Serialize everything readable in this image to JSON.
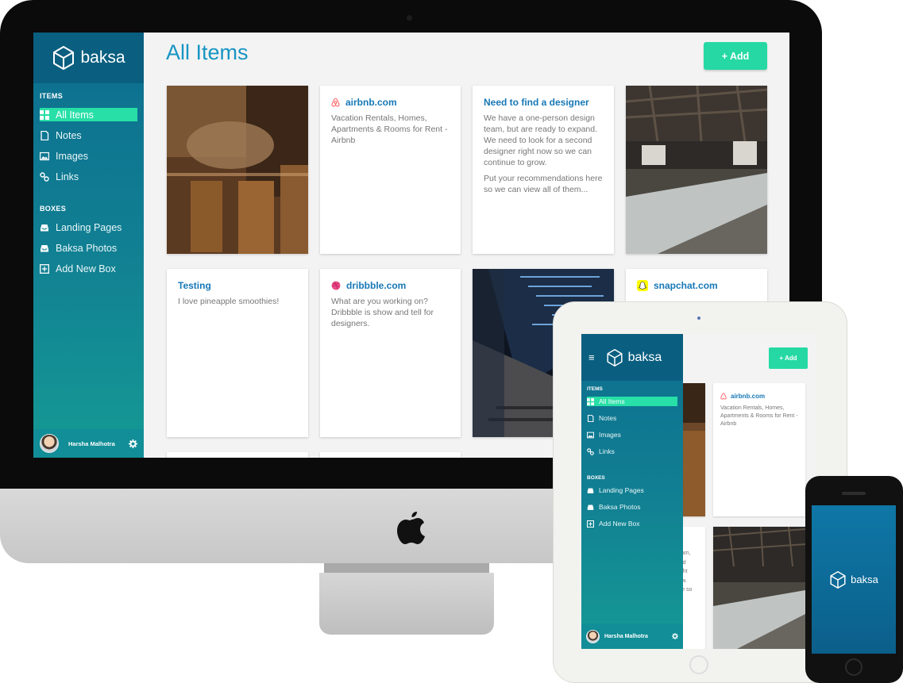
{
  "desktop": {
    "brand": "baksa",
    "page_title": "All Items",
    "add_button": "+ Add",
    "sidebar": {
      "items_heading": "ITEMS",
      "items": [
        {
          "label": "All Items",
          "icon": "grid-icon",
          "active": true
        },
        {
          "label": "Notes",
          "icon": "note-icon"
        },
        {
          "label": "Images",
          "icon": "image-icon"
        },
        {
          "label": "Links",
          "icon": "link-icon"
        }
      ],
      "boxes_heading": "BOXES",
      "boxes": [
        {
          "label": "Landing Pages",
          "icon": "inbox-icon"
        },
        {
          "label": "Baksa Photos",
          "icon": "inbox-icon"
        },
        {
          "label": "Add New Box",
          "icon": "plus-square-icon"
        }
      ],
      "user_name": "Harsha Malhotra"
    },
    "cards": {
      "airbnb": {
        "title": "airbnb.com",
        "desc": "Vacation Rentals, Homes, Apartments & Rooms for Rent - Airbnb",
        "color": "#ff5a5f"
      },
      "designer": {
        "title": "Need to find a designer",
        "desc1": "We have a one-person design team, but are ready to expand. We need to look for a second designer right now so we can continue to grow.",
        "desc2": "Put your recommendations here so we can view all of them..."
      },
      "testing": {
        "title": "Testing",
        "desc": "I love pineapple smoothies!"
      },
      "dribbble": {
        "title": "dribbble.com",
        "desc": "What are you working on? Dribbble is show and tell for designers.",
        "color": "#ea4c89"
      },
      "snapchat": {
        "title": "snapchat.com",
        "color": "#fffc00"
      }
    }
  },
  "tablet": {
    "brand": "baksa",
    "add_button": "+ Add",
    "items_heading": "ITEMS",
    "items": [
      "All Items",
      "Notes",
      "Images",
      "Links"
    ],
    "boxes_heading": "BOXES",
    "boxes": [
      "Landing Pages",
      "Baksa Photos",
      "Add New Box"
    ],
    "user_name": "Harsha Malhotra",
    "card_airbnb_title": "airbnb.com",
    "card_airbnb_desc": "Vacation Rentals, Homes, Apartments & Rooms for Rent - Airbnb",
    "partial_text": [
      "team,",
      "eed",
      "right",
      "row.",
      "ere so"
    ]
  },
  "phone": {
    "brand": "baksa"
  },
  "colors": {
    "accent": "#26d9a4",
    "title_blue": "#1795c3",
    "sidebar_top": "#0a5f80"
  }
}
